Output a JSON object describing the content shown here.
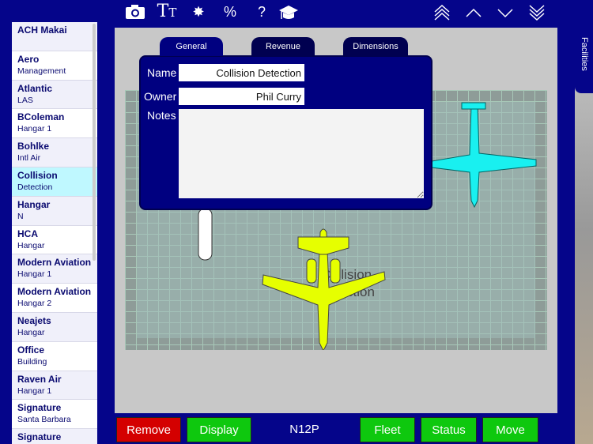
{
  "toolbar": {
    "icons": [
      "camera-icon",
      "text-size-icon",
      "burst-icon",
      "percent-icon",
      "help-icon",
      "graduation-cap-icon",
      "double-up-icon",
      "up-icon",
      "down-icon",
      "double-down-icon"
    ],
    "percent": "%",
    "help": "?"
  },
  "sidebar": {
    "items": [
      {
        "title": "ACH Makai",
        "sub": ""
      },
      {
        "title": "Aero",
        "sub": "Management"
      },
      {
        "title": "Atlantic",
        "sub": "LAS"
      },
      {
        "title": "BColeman",
        "sub": "Hangar 1"
      },
      {
        "title": "Bohlke",
        "sub": "Intl Air"
      },
      {
        "title": "Collision",
        "sub": "Detection",
        "selected": true
      },
      {
        "title": "Hangar",
        "sub": "N"
      },
      {
        "title": "HCA",
        "sub": "Hangar"
      },
      {
        "title": "Modern Aviation",
        "sub": "Hangar 1"
      },
      {
        "title": "Modern Aviation",
        "sub": "Hangar 2"
      },
      {
        "title": "Neajets",
        "sub": "Hangar"
      },
      {
        "title": "Office",
        "sub": "Building"
      },
      {
        "title": "Raven Air",
        "sub": "Hangar 1"
      },
      {
        "title": "Signature",
        "sub": "Santa Barbara"
      },
      {
        "title": "Signature",
        "sub": ""
      }
    ]
  },
  "canvas": {
    "floor_label_1": "Collision",
    "floor_label_2": "Detection"
  },
  "dialog": {
    "tabs": [
      "General",
      "Revenue",
      "Dimensions"
    ],
    "active_tab": "General",
    "name_label": "Name",
    "name_value": "Collision Detection",
    "owner_label": "Owner",
    "owner_value": "Phil Curry",
    "notes_label": "Notes",
    "notes_value": ""
  },
  "bottom": {
    "remove": "Remove",
    "display": "Display",
    "tail": "N12P",
    "fleet": "Fleet",
    "status": "Status",
    "move": "Move"
  },
  "side_tab": "Facilities",
  "colors": {
    "navy": "#05058a",
    "green": "#0ec80e",
    "red": "#cc0000",
    "selected": "#bff8ff"
  }
}
